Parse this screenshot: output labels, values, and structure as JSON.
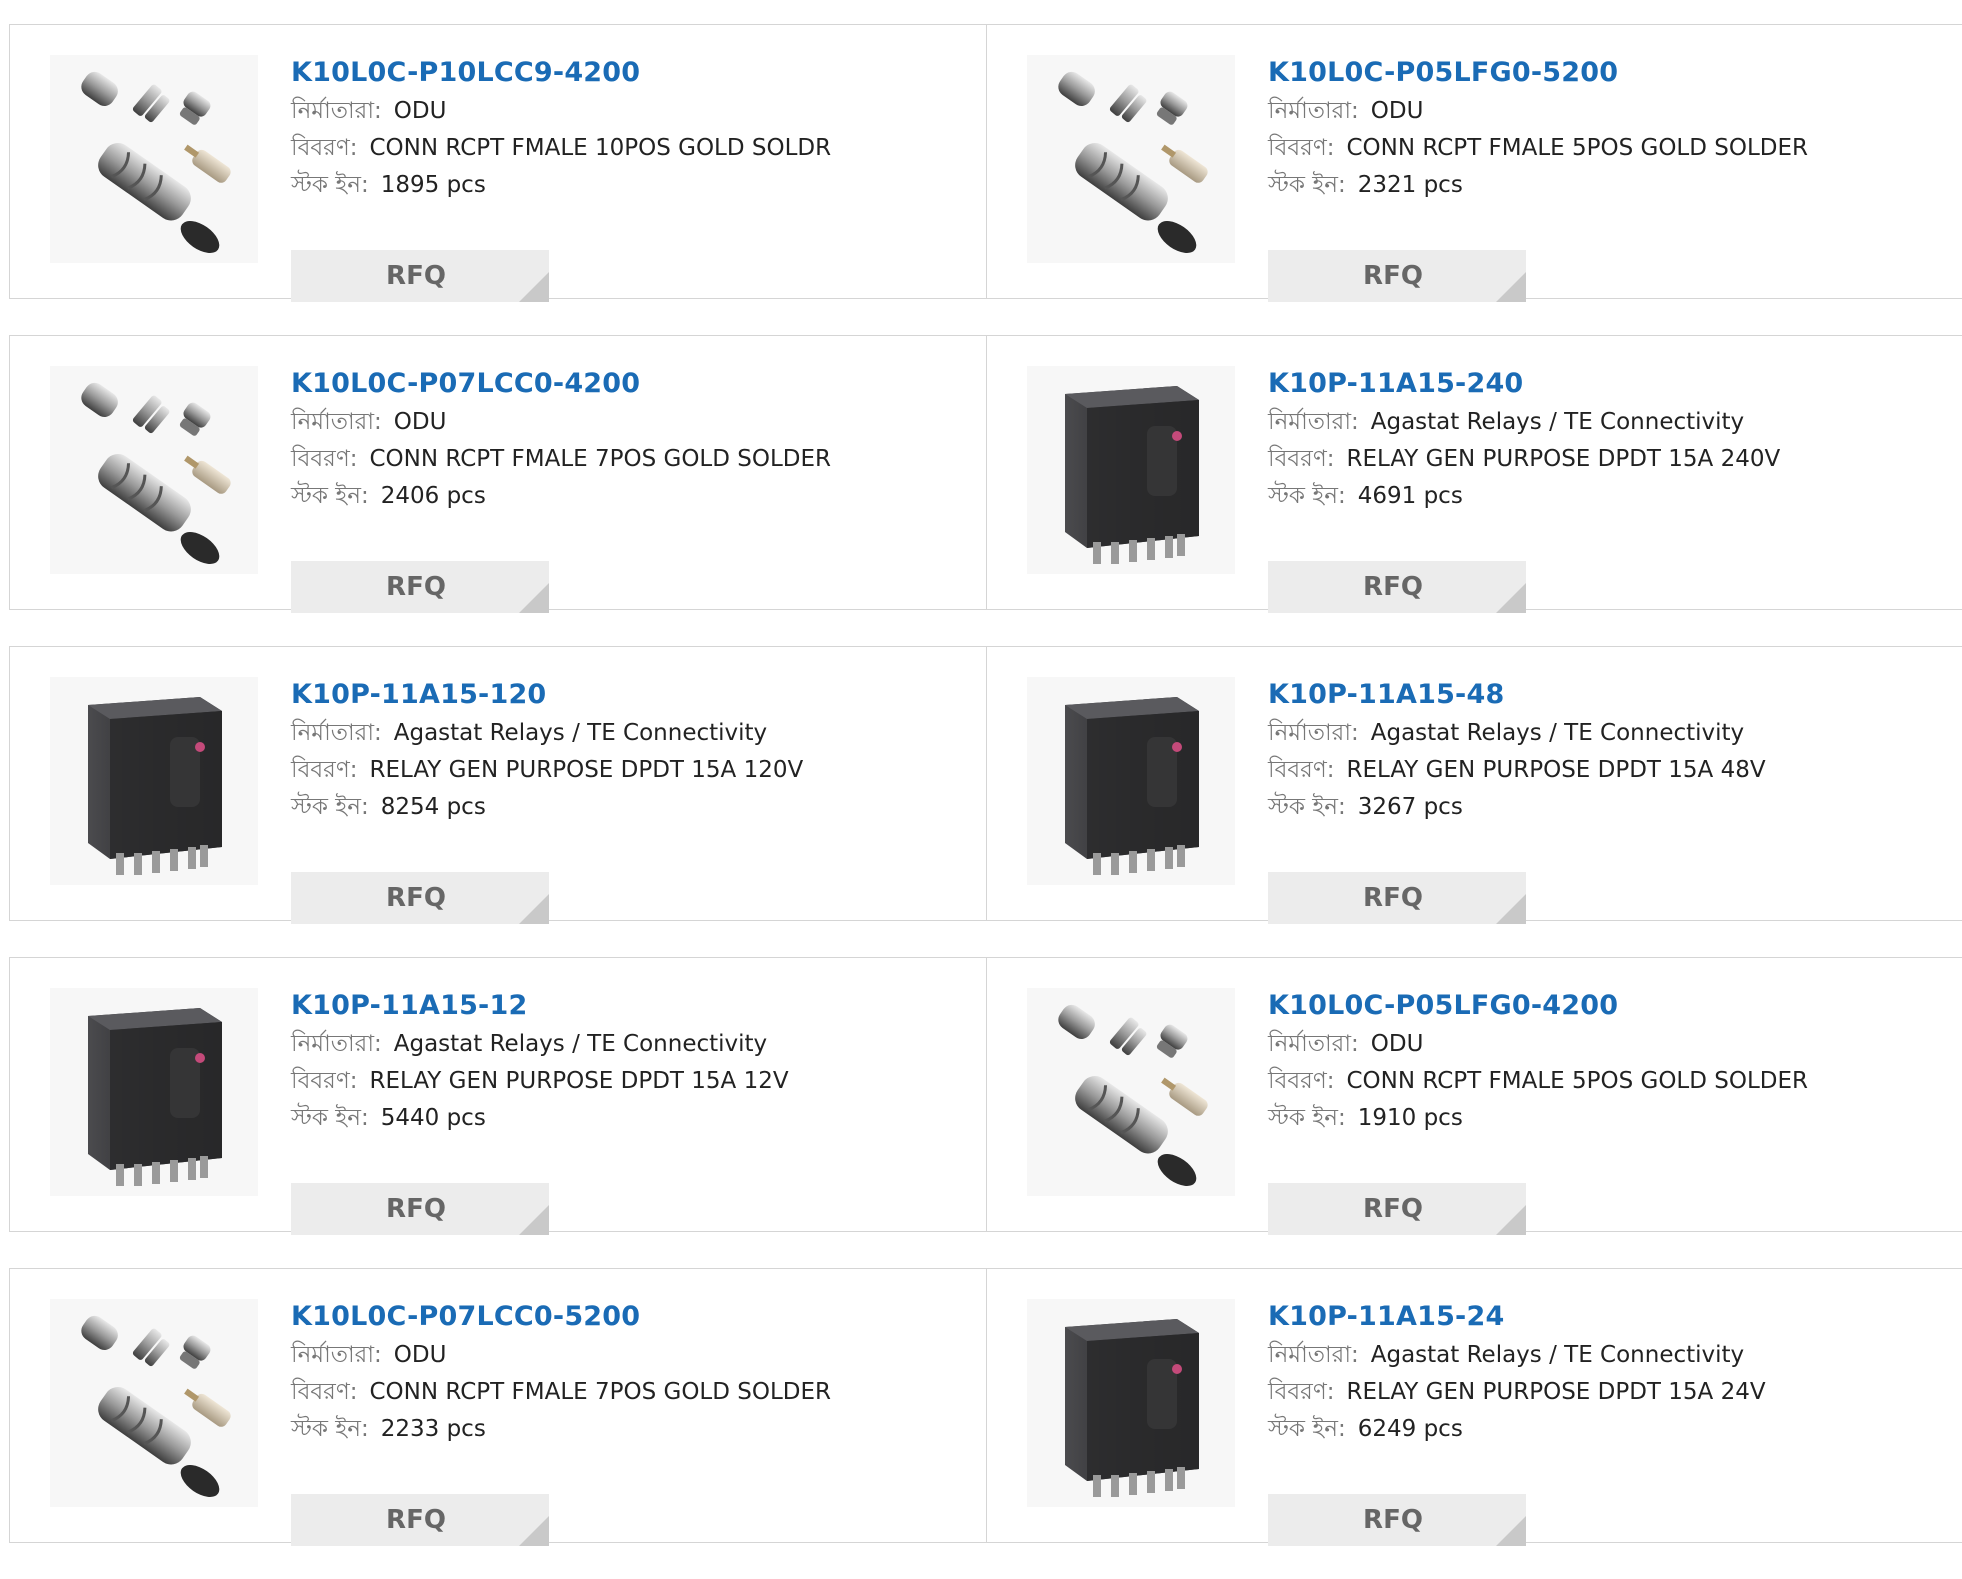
{
  "labels": {
    "manufacturer": "নির্মাতারা:",
    "description": "বিবরণ:",
    "stock": "স্টক ইন:",
    "rfq": "RFQ"
  },
  "products": [
    {
      "part": "K10L0C-P10LCC9-4200",
      "manufacturer": "ODU",
      "description": "CONN RCPT FMALE 10POS GOLD SOLDR",
      "stock": "1895 pcs",
      "image": "connector-kit"
    },
    {
      "part": "K10L0C-P05LFG0-5200",
      "manufacturer": "ODU",
      "description": "CONN RCPT FMALE 5POS GOLD SOLDER",
      "stock": "2321 pcs",
      "image": "connector-kit"
    },
    {
      "part": "K10L0C-P07LCC0-4200",
      "manufacturer": "ODU",
      "description": "CONN RCPT FMALE 7POS GOLD SOLDER",
      "stock": "2406 pcs",
      "image": "connector-kit"
    },
    {
      "part": "K10P-11A15-240",
      "manufacturer": "Agastat Relays / TE Connectivity",
      "description": "RELAY GEN PURPOSE DPDT 15A 240V",
      "stock": "4691 pcs",
      "image": "relay"
    },
    {
      "part": "K10P-11A15-120",
      "manufacturer": "Agastat Relays / TE Connectivity",
      "description": "RELAY GEN PURPOSE DPDT 15A 120V",
      "stock": "8254 pcs",
      "image": "relay"
    },
    {
      "part": "K10P-11A15-48",
      "manufacturer": "Agastat Relays / TE Connectivity",
      "description": "RELAY GEN PURPOSE DPDT 15A 48V",
      "stock": "3267 pcs",
      "image": "relay"
    },
    {
      "part": "K10P-11A15-12",
      "manufacturer": "Agastat Relays / TE Connectivity",
      "description": "RELAY GEN PURPOSE DPDT 15A 12V",
      "stock": "5440 pcs",
      "image": "relay"
    },
    {
      "part": "K10L0C-P05LFG0-4200",
      "manufacturer": "ODU",
      "description": "CONN RCPT FMALE 5POS GOLD SOLDER",
      "stock": "1910 pcs",
      "image": "connector-kit"
    },
    {
      "part": "K10L0C-P07LCC0-5200",
      "manufacturer": "ODU",
      "description": "CONN RCPT FMALE 7POS GOLD SOLDER",
      "stock": "2233 pcs",
      "image": "connector-kit"
    },
    {
      "part": "K10P-11A15-24",
      "manufacturer": "Agastat Relays / TE Connectivity",
      "description": "RELAY GEN PURPOSE DPDT 15A 24V",
      "stock": "6249 pcs",
      "image": "relay"
    }
  ],
  "colors": {
    "link": "#1a6bb5",
    "border": "#d5d5d5",
    "button_bg": "#ececec",
    "button_text": "#666666"
  }
}
